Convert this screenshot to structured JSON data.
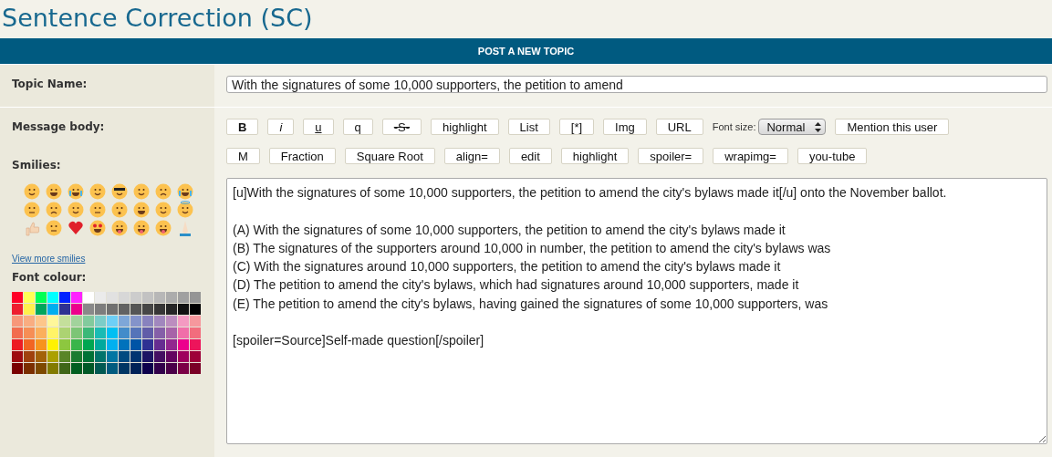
{
  "page_title": "Sentence Correction (SC)",
  "form_header": "POST A NEW TOPIC",
  "topic": {
    "label": "Topic Name:",
    "value": "With the signatures of some 10,000 supporters, the petition to amend"
  },
  "message": {
    "label": "Message body:",
    "toolbar_1": [
      {
        "label": "B",
        "kind": "bold"
      },
      {
        "label": "i",
        "kind": "italic"
      },
      {
        "label": "u",
        "kind": "underline"
      },
      {
        "label": "q",
        "kind": "plain"
      },
      {
        "label": "-S-",
        "kind": "strike"
      },
      {
        "label": "highlight",
        "kind": "plain"
      },
      {
        "label": "List",
        "kind": "plain"
      },
      {
        "label": "[*]",
        "kind": "plain"
      },
      {
        "label": "Img",
        "kind": "plain"
      },
      {
        "label": "URL",
        "kind": "plain"
      }
    ],
    "font_size": {
      "label": "Font size:",
      "value": "Normal"
    },
    "mention_button": "Mention this user",
    "toolbar_2": [
      "M",
      "Fraction",
      "Square Root",
      "align=",
      "edit",
      "highlight",
      "spoiler=",
      "wrapimg=",
      "you-tube"
    ],
    "body": "[u]With the signatures of some 10,000 supporters, the petition to amend the city's bylaws made it[/u] onto the November ballot.\n\n(A) With the signatures of some 10,000 supporters, the petition to amend the city's bylaws made it\n(B) The signatures of the supporters around 10,000 in number, the petition to amend the city's bylaws was\n(C) With the signatures around 10,000 supporters, the petition to amend the city's bylaws made it\n(D) The petition to amend the city's bylaws, which had signatures around 10,000 supporters, made it\n(E) The petition to amend the city's bylaws, having gained the signatures of some 10,000 supporters, was\n\n[spoiler=Source]Self-made question[/spoiler]"
  },
  "smilies": {
    "label": "Smilies:",
    "link": "View more smilies",
    "items": [
      {
        "kind": "smile"
      },
      {
        "kind": "grin"
      },
      {
        "kind": "tears"
      },
      {
        "kind": "wink"
      },
      {
        "kind": "cool"
      },
      {
        "kind": "blush"
      },
      {
        "kind": "worried"
      },
      {
        "kind": "cry"
      },
      {
        "kind": "confused"
      },
      {
        "kind": "angry"
      },
      {
        "kind": "eyeroll"
      },
      {
        "kind": "neutral"
      },
      {
        "kind": "surprised"
      },
      {
        "kind": "shock"
      },
      {
        "kind": "dizzy"
      },
      {
        "kind": "angel"
      },
      {
        "kind": "thumbsup"
      },
      {
        "kind": "zipped"
      },
      {
        "kind": "heart"
      },
      {
        "kind": "hearteyes"
      },
      {
        "kind": "tongue"
      },
      {
        "kind": "yum"
      },
      {
        "kind": "squint"
      },
      {
        "kind": "pray"
      }
    ]
  },
  "font_colour": {
    "label": "Font colour:",
    "rows": [
      {
        "swatches": [
          {
            "color": "#ff0027"
          },
          {
            "color": "#ffff55"
          },
          {
            "color": "#00ff55"
          },
          {
            "color": "#00ffff"
          },
          {
            "color": "#0022ff"
          },
          {
            "color": "#ff22ff"
          },
          {
            "color": "#ffffff"
          },
          {
            "color": "#ebebeb"
          },
          {
            "color": "#e1e1e1"
          },
          {
            "color": "#d7d7d7"
          },
          {
            "color": "#cccccc"
          },
          {
            "color": "#c2c2c2"
          },
          {
            "color": "#b7b7b7"
          },
          {
            "color": "#acacac"
          },
          {
            "color": "#a0a0a0"
          },
          {
            "color": "#959595"
          }
        ]
      },
      {
        "swatches": [
          {
            "color": "#ee1d2f"
          },
          {
            "color": "#fff04d"
          },
          {
            "color": "#00a65d"
          },
          {
            "color": "#00aeef"
          },
          {
            "color": "#2e3192"
          },
          {
            "color": "#ec008c"
          },
          {
            "color": "#898989"
          },
          {
            "color": "#7d7d7d"
          },
          {
            "color": "#707070"
          },
          {
            "color": "#626262"
          },
          {
            "color": "#555555"
          },
          {
            "color": "#464646"
          },
          {
            "color": "#363636"
          },
          {
            "color": "#262626"
          },
          {
            "color": "#111111"
          },
          {
            "color": "#000000"
          }
        ]
      },
      {
        "swatches": [
          {
            "color": "#f7977a"
          },
          {
            "color": "#f9ad81"
          },
          {
            "color": "#fdc68a"
          },
          {
            "color": "#fff79a"
          },
          {
            "color": "#c4df9b"
          },
          {
            "color": "#a2d39c"
          },
          {
            "color": "#82ca9d"
          },
          {
            "color": "#7bcdc8"
          },
          {
            "color": "#6ecff6"
          },
          {
            "color": "#7ea7d8"
          },
          {
            "color": "#8493ca"
          },
          {
            "color": "#8882be"
          },
          {
            "color": "#a187be"
          },
          {
            "color": "#bc8dbf"
          },
          {
            "color": "#f49ac2"
          },
          {
            "color": "#f6989d"
          }
        ]
      },
      {
        "swatches": [
          {
            "color": "#f26c4f"
          },
          {
            "color": "#f68e55"
          },
          {
            "color": "#fbaf5c"
          },
          {
            "color": "#fff467"
          },
          {
            "color": "#acd372"
          },
          {
            "color": "#7cc576"
          },
          {
            "color": "#3bb878"
          },
          {
            "color": "#1abbb4"
          },
          {
            "color": "#00bff3"
          },
          {
            "color": "#438cca"
          },
          {
            "color": "#5574b9"
          },
          {
            "color": "#605ca8"
          },
          {
            "color": "#855fa8"
          },
          {
            "color": "#a763a8"
          },
          {
            "color": "#f06ea9"
          },
          {
            "color": "#f26d7d"
          }
        ]
      },
      {
        "swatches": [
          {
            "color": "#ed1c24"
          },
          {
            "color": "#f26522"
          },
          {
            "color": "#f7941d"
          },
          {
            "color": "#fff200"
          },
          {
            "color": "#8dc73f"
          },
          {
            "color": "#39b54a"
          },
          {
            "color": "#00a651"
          },
          {
            "color": "#00a99d"
          },
          {
            "color": "#00b0f0"
          },
          {
            "color": "#0072bc"
          },
          {
            "color": "#0054a6"
          },
          {
            "color": "#2e3193"
          },
          {
            "color": "#662d91"
          },
          {
            "color": "#92278f"
          },
          {
            "color": "#ec008d"
          },
          {
            "color": "#ed145b"
          }
        ]
      },
      {
        "swatches": [
          {
            "color": "#9e0b0f"
          },
          {
            "color": "#a0410d"
          },
          {
            "color": "#a36209"
          },
          {
            "color": "#aba000"
          },
          {
            "color": "#598527"
          },
          {
            "color": "#1a7b30"
          },
          {
            "color": "#007236"
          },
          {
            "color": "#00746b"
          },
          {
            "color": "#0076a3"
          },
          {
            "color": "#004b80"
          },
          {
            "color": "#003471"
          },
          {
            "color": "#1b1464"
          },
          {
            "color": "#440e62"
          },
          {
            "color": "#630460"
          },
          {
            "color": "#9e005d"
          },
          {
            "color": "#9e0039"
          }
        ]
      },
      {
        "swatches": [
          {
            "color": "#790000"
          },
          {
            "color": "#7b2e00"
          },
          {
            "color": "#7d4900"
          },
          {
            "color": "#827b00"
          },
          {
            "color": "#406618"
          },
          {
            "color": "#005e20"
          },
          {
            "color": "#005826"
          },
          {
            "color": "#005952"
          },
          {
            "color": "#005b7f"
          },
          {
            "color": "#003663"
          },
          {
            "color": "#002157"
          },
          {
            "color": "#0d004c"
          },
          {
            "color": "#32004b"
          },
          {
            "color": "#4b0049"
          },
          {
            "color": "#7b0046"
          },
          {
            "color": "#7a0026"
          }
        ]
      }
    ]
  }
}
